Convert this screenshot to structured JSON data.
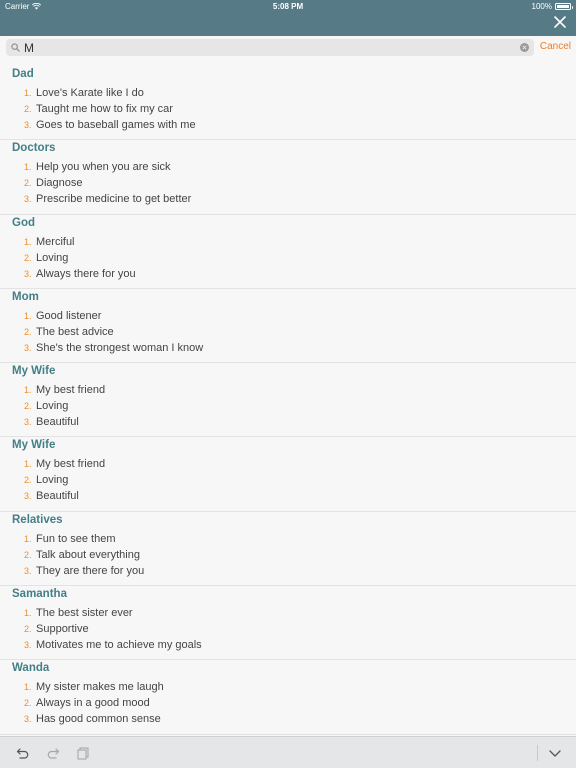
{
  "status_bar": {
    "carrier": "Carrier",
    "time": "5:08 PM",
    "battery": "100%",
    "battery_level": 1.0
  },
  "search": {
    "value": "M",
    "cancel_label": "Cancel"
  },
  "sections": [
    {
      "title": "Dad",
      "items": [
        "Love's Karate like I do",
        "Taught me how to fix my car",
        "Goes to baseball games with me"
      ]
    },
    {
      "title": "Doctors",
      "items": [
        "Help you when you are sick",
        "Diagnose",
        "Prescribe medicine to get better"
      ]
    },
    {
      "title": "God",
      "items": [
        "Merciful",
        "Loving",
        "Always there for you"
      ]
    },
    {
      "title": "Mom",
      "items": [
        "Good listener",
        "The best advice",
        "She's the strongest woman I know"
      ]
    },
    {
      "title": "My Wife",
      "items": [
        "My best friend",
        "Loving",
        "Beautiful"
      ]
    },
    {
      "title": "My Wife",
      "items": [
        "My best friend",
        "Loving",
        "Beautiful"
      ]
    },
    {
      "title": "Relatives",
      "items": [
        "Fun to see them",
        "Talk about everything",
        "They are there for you"
      ]
    },
    {
      "title": "Samantha",
      "items": [
        "The best sister ever",
        "Supportive",
        "Motivates me to achieve my goals"
      ]
    },
    {
      "title": "Wanda",
      "items": [
        "My sister makes me laugh",
        "Always in a good mood",
        "Has good common sense"
      ]
    }
  ],
  "item_numbers": [
    "1.",
    "2.",
    "3."
  ],
  "colors": {
    "header_bg": "#577b86",
    "section_title": "#427f86",
    "accent_orange": "#ef7d22"
  },
  "icons": {
    "close": "close-icon",
    "search": "search-icon",
    "clear": "clear-icon",
    "undo": "undo-icon",
    "redo": "redo-icon",
    "paste": "paste-icon",
    "dismiss_keyboard": "chevron-down-icon"
  }
}
